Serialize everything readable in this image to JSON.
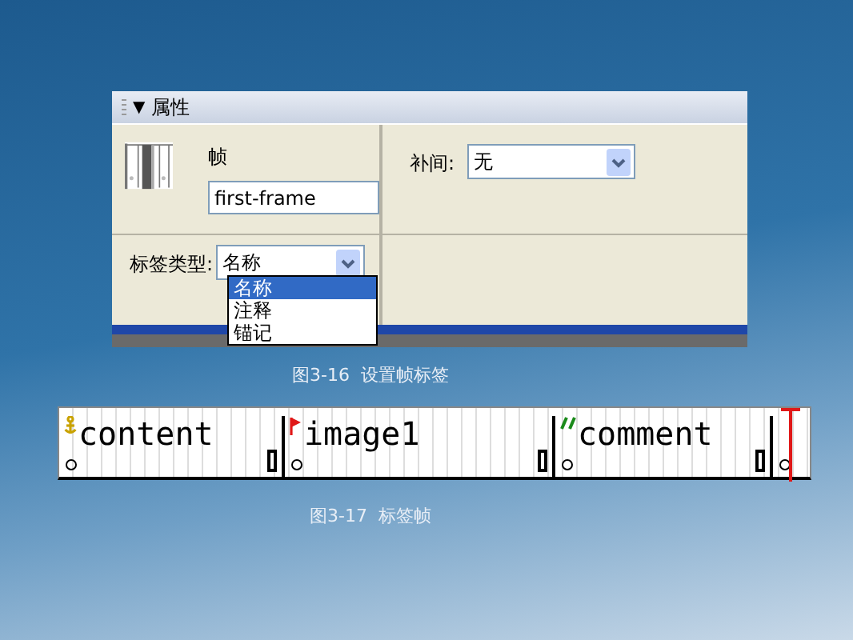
{
  "properties_panel": {
    "collapse_glyph": "▼",
    "title": "属性",
    "frame_label": "帧",
    "frame_name": "first-frame",
    "tween_label": "补间:",
    "tween_value": "无",
    "label_type_label": "标签类型:",
    "label_type_value": "名称",
    "label_type_options": [
      {
        "label": "名称",
        "selected": true
      },
      {
        "label": "注释",
        "selected": false
      },
      {
        "label": "锚记",
        "selected": false
      }
    ]
  },
  "caption_1": "图3-16  设置帧标签",
  "timeline_frames": [
    {
      "kind": "anchor",
      "label": "content"
    },
    {
      "kind": "name",
      "label": "image1"
    },
    {
      "kind": "comment",
      "label": "comment"
    }
  ],
  "caption_2": "图3-17  标签帧"
}
